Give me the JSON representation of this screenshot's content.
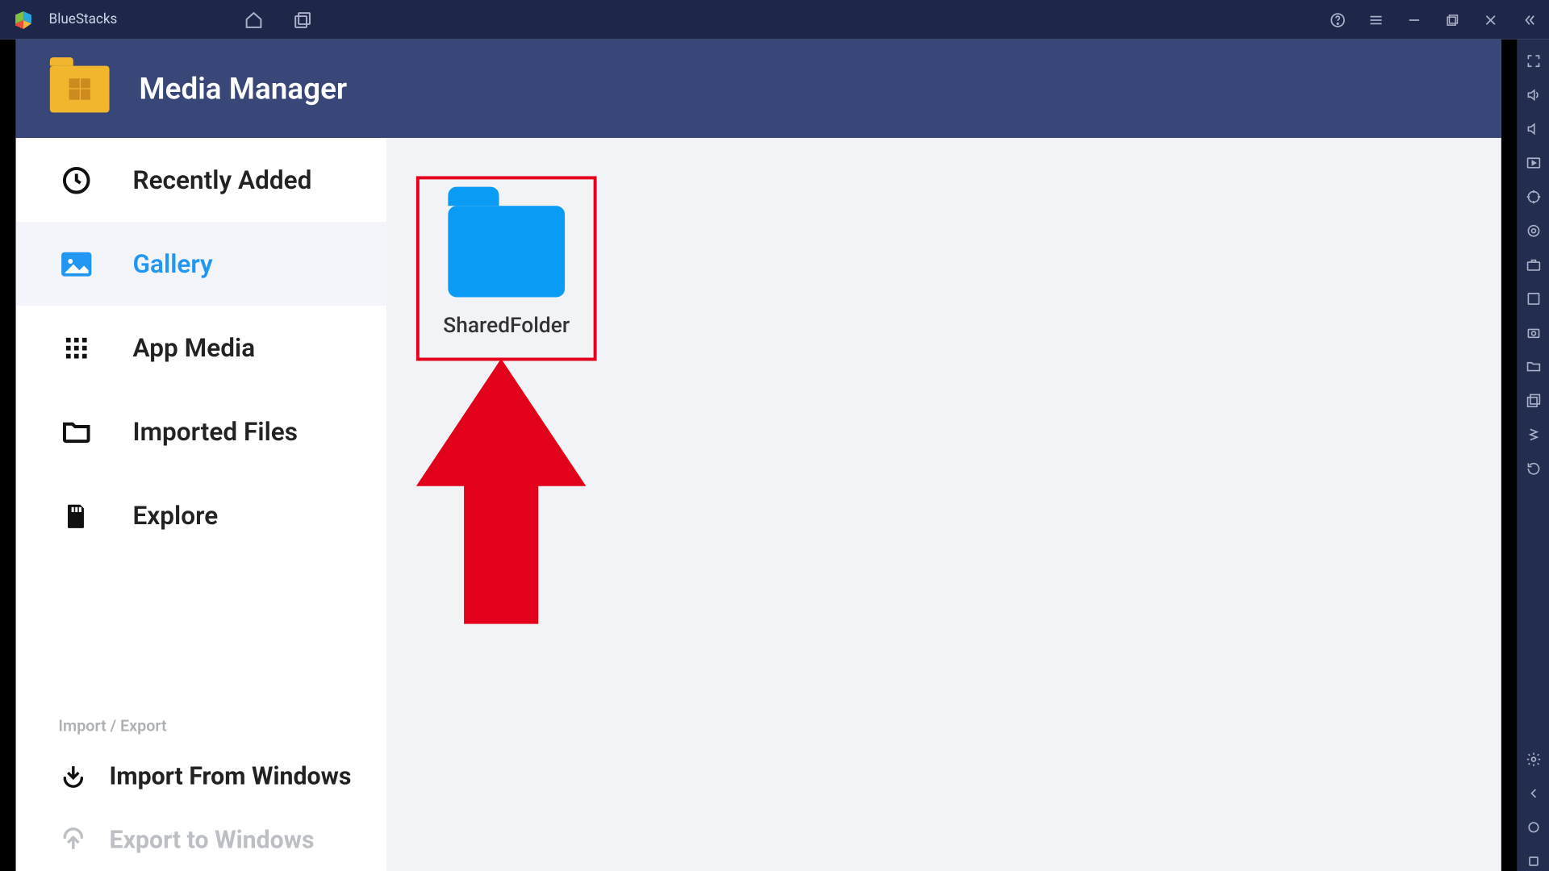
{
  "titlebar": {
    "app_name": "BlueStacks"
  },
  "app_header": {
    "title": "Media Manager"
  },
  "sidebar": {
    "items": [
      {
        "id": "recent",
        "label": "Recently Added",
        "icon": "clock-icon",
        "active": false
      },
      {
        "id": "gallery",
        "label": "Gallery",
        "icon": "image-icon",
        "active": true
      },
      {
        "id": "appmedia",
        "label": "App Media",
        "icon": "grid-icon",
        "active": false
      },
      {
        "id": "imported",
        "label": "Imported Files",
        "icon": "folder-outline-icon",
        "active": false
      },
      {
        "id": "explore",
        "label": "Explore",
        "icon": "sdcard-icon",
        "active": false
      }
    ],
    "import_section_label": "Import / Export",
    "import_items": [
      {
        "id": "import",
        "label": "Import From Windows",
        "icon": "import-icon",
        "disabled": false
      },
      {
        "id": "export",
        "label": "Export to Windows",
        "icon": "export-icon",
        "disabled": true
      }
    ]
  },
  "content": {
    "folders": [
      {
        "name": "SharedFolder"
      }
    ]
  },
  "annotation": {
    "type": "red-arrow-up",
    "color": "#e2001a"
  },
  "right_rail": {
    "icons": [
      "fullscreen-icon",
      "volume-up-icon",
      "volume-down-icon",
      "play-rect-icon",
      "target-icon",
      "locate-icon",
      "briefcase-icon",
      "apk-icon",
      "screenshot-icon",
      "folder-open-icon",
      "multi-window-icon",
      "shake-icon",
      "rotate-icon"
    ],
    "bottom_icons": [
      "gear-icon",
      "back-icon",
      "home-small-icon",
      "recents-icon"
    ]
  }
}
